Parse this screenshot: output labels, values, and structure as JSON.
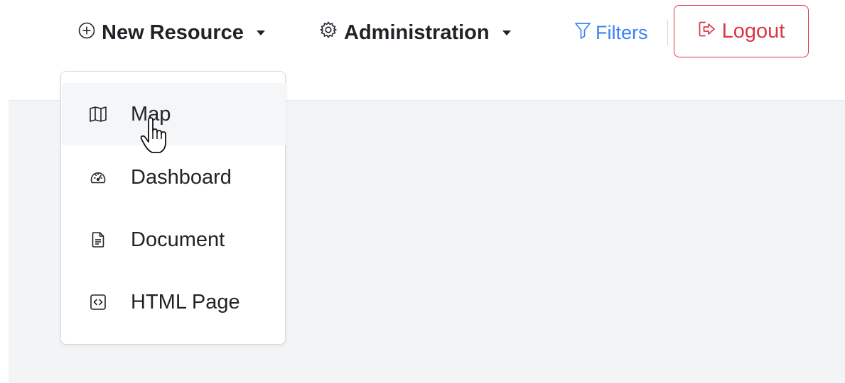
{
  "navbar": {
    "new_resource": {
      "label": "New Resource",
      "icon": "plus-circle-icon"
    },
    "administration": {
      "label": "Administration",
      "icon": "gear-icon"
    },
    "filters": {
      "label": "Filters",
      "icon": "filter-icon",
      "color": "#3b82f6"
    },
    "logout": {
      "label": "Logout",
      "icon": "logout-icon",
      "color": "#dc3545"
    }
  },
  "dropdown": {
    "items": [
      {
        "label": "Map",
        "icon": "map-icon",
        "hovered": true
      },
      {
        "label": "Dashboard",
        "icon": "dashboard-gauge-icon"
      },
      {
        "label": "Document",
        "icon": "document-icon"
      },
      {
        "label": "HTML Page",
        "icon": "code-brackets-icon"
      }
    ]
  },
  "colors": {
    "content_background": "#f3f4f6",
    "text": "#1f2328",
    "hover_background": "#f5f6f8"
  }
}
